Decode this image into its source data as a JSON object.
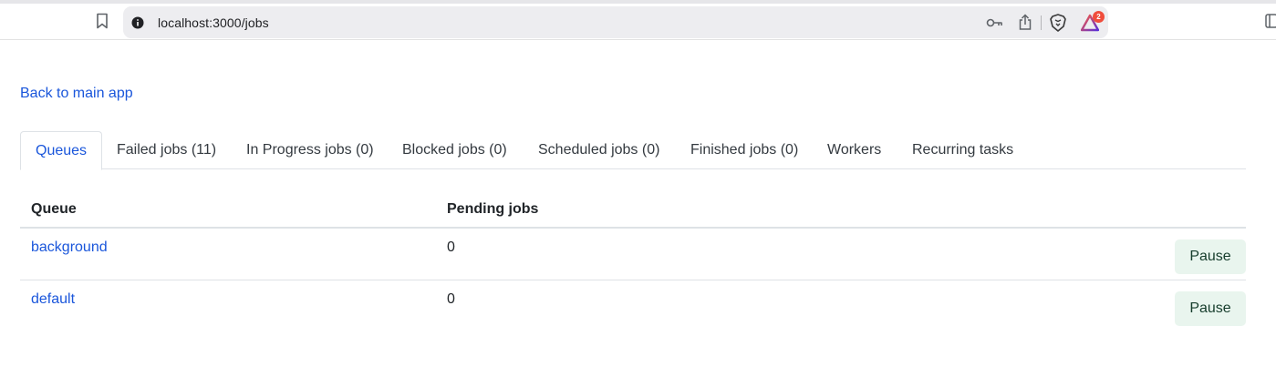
{
  "browser": {
    "url": "localhost:3000/jobs",
    "notification_badge": "2"
  },
  "page": {
    "back_link": "Back to main app"
  },
  "tabs": [
    {
      "label": "Queues",
      "active": true
    },
    {
      "label": "Failed jobs (11)"
    },
    {
      "label": "In Progress jobs (0)"
    },
    {
      "label": "Blocked jobs (0)"
    },
    {
      "label": "Scheduled jobs (0)"
    },
    {
      "label": "Finished jobs (0)"
    },
    {
      "label": "Workers"
    },
    {
      "label": "Recurring tasks"
    }
  ],
  "table": {
    "headers": [
      "Queue",
      "Pending jobs"
    ],
    "rows": [
      {
        "queue": "background",
        "pending": "0",
        "action": "Pause"
      },
      {
        "queue": "default",
        "pending": "0",
        "action": "Pause"
      }
    ]
  },
  "colors": {
    "link": "#1a56db",
    "pause_button_bg": "#e9f5ee",
    "pause_button_text": "#163d2c"
  },
  "icons": [
    "bookmark-icon",
    "site-info-icon",
    "key-icon",
    "share-icon",
    "brave-shield-icon",
    "brave-rewards-icon"
  ]
}
